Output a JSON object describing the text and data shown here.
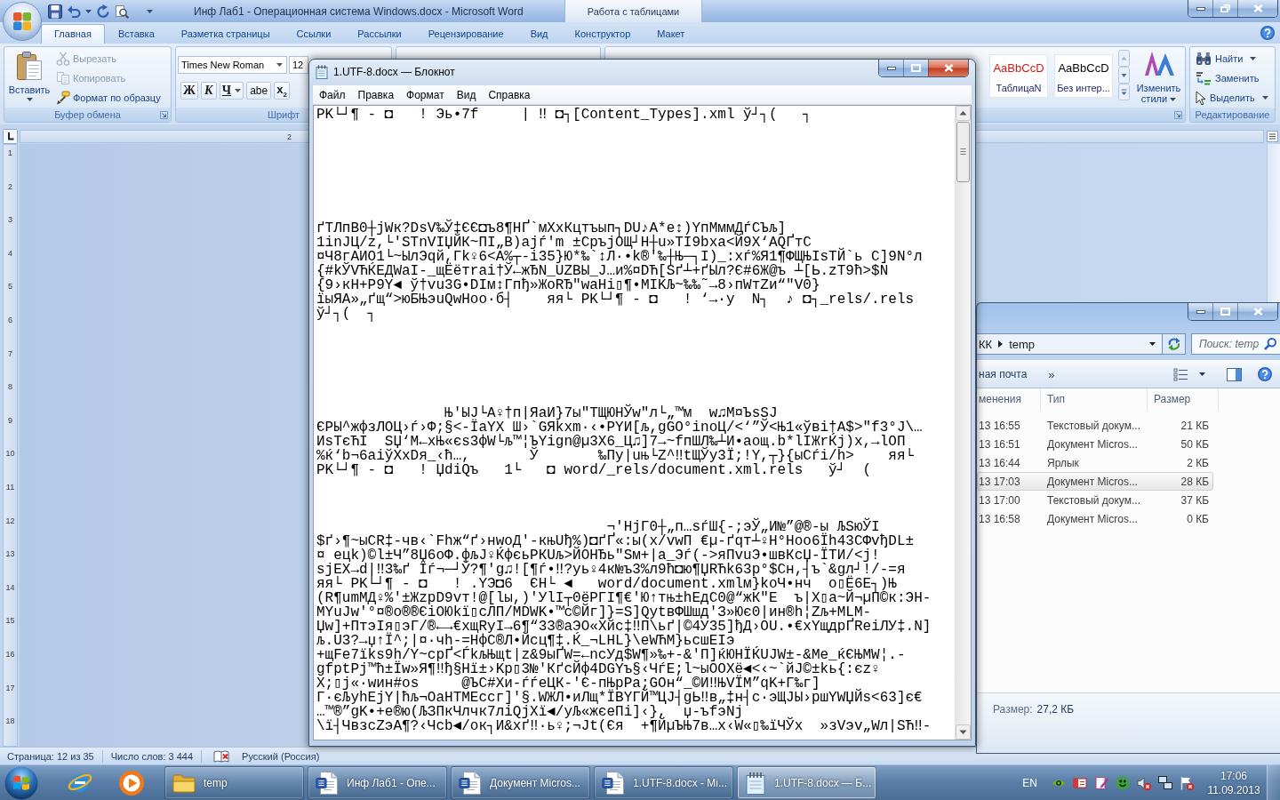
{
  "word": {
    "title": "Инф Лаб1 - Операционная система Windows.docx - Microsoft Word",
    "active": false,
    "contextual_group": "Работа с таблицами",
    "tabs": [
      {
        "label": "Главная",
        "selected": true
      },
      {
        "label": "Вставка",
        "selected": false
      },
      {
        "label": "Разметка страницы",
        "selected": false
      },
      {
        "label": "Ссылки",
        "selected": false
      },
      {
        "label": "Рассылки",
        "selected": false
      },
      {
        "label": "Рецензирование",
        "selected": false
      },
      {
        "label": "Вид",
        "selected": false
      },
      {
        "label": "Конструктор",
        "selected": false
      },
      {
        "label": "Макет",
        "selected": false
      }
    ],
    "ribbon": {
      "clipboard": {
        "label": "Буфер обмена",
        "paste": "Вставить",
        "actions": [
          {
            "label": "Вырезать",
            "kind": "cut",
            "disabled": true
          },
          {
            "label": "Копировать",
            "kind": "copy",
            "disabled": true
          },
          {
            "label": "Формат по образцу",
            "kind": "format-painter",
            "disabled": false
          }
        ]
      },
      "font": {
        "label": "Шрифт",
        "font_name": "Times New Roman",
        "font_size": "12",
        "buttons": [
          {
            "label": "Ж",
            "kind": "bold",
            "dropdown": false
          },
          {
            "label": "К",
            "kind": "italic",
            "dropdown": false
          },
          {
            "label": "Ч",
            "kind": "underline",
            "dropdown": true
          },
          {
            "label": "abe",
            "kind": "strike",
            "dropdown": false
          },
          {
            "label": "x$_{2}$",
            "kind": "subscript",
            "dropdown": false
          }
        ]
      },
      "styles": {
        "tiles": [
          {
            "sample": "AaBbCcD",
            "name": "ТаблицаN",
            "color": "#d01818"
          },
          {
            "sample": "AaBbCcD",
            "name": "Без интер...",
            "color": "#000000"
          }
        ],
        "change_styles": "Изменить стили"
      },
      "editing": {
        "label": "Редактирование",
        "actions": [
          {
            "label": "Найти",
            "kind": "find",
            "dropdown": true
          },
          {
            "label": "Заменить",
            "kind": "replace",
            "dropdown": false
          },
          {
            "label": "Выделить",
            "kind": "select",
            "dropdown": true
          }
        ]
      }
    },
    "ruler": {
      "label": "2"
    },
    "vertical_ruler": [
      "1",
      "2",
      "3",
      "4",
      "5",
      "6",
      "7",
      "8",
      "9",
      "10",
      "11",
      "12",
      "13",
      "14",
      "15",
      "16",
      "17",
      "18"
    ],
    "status_bar": {
      "page": "Страница: 12 из 35",
      "words": "Число слов: 3 444",
      "language": "Русский (Россия)"
    }
  },
  "notepad": {
    "title": "1.UTF-8.docx — Блокнот",
    "active": true,
    "menu": [
      "Файл",
      "Правка",
      "Формат",
      "Вид",
      "Справка"
    ],
    "text": "PK└┘¶ - ◘   ! Эь•7f     | ‼ ◘┐[Content_Types].xml ў┘┐(   ┐\n\n\n\n\n\n\n\nґTЛпВ0┼jWк?DsV‰Ў‡ЄЄ◘ъ8¶НҐ`мХхКцтъып┐DU♪А*е↕)YпМммДѓСЪљ]\n1inJЦ/z,└'STnVIЏЙК~ПI„B)ajѓ'm ±СръjОЩ┘Н┼u»TI9bxa<Й9X‘AQҐтС\n¤Ч8гАИО1└~ЫлЭqй,Гk♀6<A%┬-i35}Ю*‰`↕Л·•k®'‰┼Њ─┐I)_:xѓ%Я1¶ФЩЊIsTЙ`ь С]9N°л\n{#kЎVЋЌЕДWaI-_щЁётrai†Ў←жЂN_UZBЫ_J…и%¤DЋ[Sґ┴+ґЫл?Є#6Ж@ъ ┴[Ь.zT9ћ>$N\n{9›кН+P9Y◄ ў†vu3G•DIм↕Гпђ»ЖоRЂ\"waHi▯¶•MIKЉ~‰‰˜→8›пWтZи“\"V0}\nїыЯА»„ґщ“>юБЊэuQwHoo·б┤    яя└ PK└┘¶ - ◘   ! ‘→·y  N┐  ♪ ◘┐_rels/.rels\nў┘┐(  ┐\n\n\n\n\n\n\n               Њ'ЫJ└A♀†п|ЯаИ}7ы\"ТЩЮНЎw\"л└„™м  w♫М¤ЪsSJ\nЄРЫ^жфзЛОЦ›ѓ›Ф;§<-ЇаYX Ш›`GЯkxm·‹•PYИ[љ,gGO°inoЦ/<‘”Ў<Њ1«ўвi†A$>\"f3°J\\…\nИsTєЋI  SЏ‘М←хЊ«єs3фW└љ™¦ЪYign@µ3X6_Ц♫]7→~fпШЛ‰┴И•аощ.b*lIЖrЌj)x,→lОП\n%ќ‘b¬6aiўXxDя_‹ћ…,       Ў       ‰Пy|uњ└Z^‼tЩЎy3Ї;!Y,┬}{ыСѓi/h>    яя└\nPK└┘¶ - ◘   ! ЏdiQъ   1└   ◘ word/_rels/document.xml.rels   ў┘  (\n\n\n\n                                  ¬'HjГ0┼„п…sѓШ{-;эЎ„И№”@®-ы ЉSюЎI\n$ґ›¶~ыCR‡-чв‹`Fhж“ґ›нwoД'-књUђ%)◘ґҐ«:ы(x/vwП €µ-ґqт┴♀Н°Нoo6Їh43CФvђDL±\n¤ eцk)©l±Ч”8Џ6оФ.фљJ♀ЌфєьРКUљ>ЙОНЂь\"Sм+|a_Эѓ(->яПvuЭ•швКсЏ-ЇТИ/<j!\nsjEX→d|‼3‰ґ Їѓ¬─┘Ў?¶'g♫![¶ѓ•‼?уь♀4к№ъ3%л9ћ◘ю¶ЏRЋk63p°$Сн,┤ъ`&gл┘!/-=я\nяя└ PK└┘¶ - ◘   ! .YЭ◘6  ЄН└ ◄   word/document.xmlм}koЧ•нч  o▯Ё6Е┐)Њ\n(R¶umМД♀%'±ЖzpD9vт!@[lы,)'УlI┬0ёРГI¶€'Ю↑тњ±hЕдС0@“жК\"Е  ъ|X▯a~Й¬µП©к:ЭН-\nМYuJw'°¤®o®®ЄiОЮkї▯сЛП/MDWK•™с©Йг]}=S]QуtвФШшд'З»Ює0|ин®h¦Zљ+MLM-\nЏw]+ПтэIя▯эГ/®←→€хщRyI→6¶“33®аЭО«Хйс‡‼П\\ьґ|©4У35]ђД›OU.•€хYщдрҐReiЛУ‡.N]\nљ.U3?→џ↑Ї^;|¤·чh-=НфС®Л•Йсц¶‡.Ќ_¬LHL}\\eWЋМ}ьсшЕIэ\n+щFe7їks9h/Y~cpҐ<ЃkљЊщt|z&9ыҐW=←ncУд$W¶»‰+-&'П]ќЮНЇЌUJW±-&Me_ќЄЊМW¦.-\ngfptPj™ћ±Їw»Я¶‼ђ§Hї±›Kp▯3№'КґсЙф4DGYъ§‹ЧѓЕ;l~ыОOXё◄<‹~`йJ©±kь{:єz♀\nX;▯j«·wин#os     @ЪС#Хи-ѓѓеЦК-'Є-пЊрPa;GOн“_©И‼ЊVЇМ”qK+Г‰г]\nГ·єЉyhEjY|ћљ¬OaHTMEccг]'§.WЖЛ•иЛщ*ЇBYГЙ™ЦJ┤gЬ‼в„‡н┤с·эЩJЫ›ршYWЏЙs<63]є€\n…™®”gK•+e®ю(ЉЗПкЧлчк7лiQjXї◄/уЉ«жєеПi]‹},  џ-ъfэNj\n\\ї┤ЧвзсZэA¶?‹Чcb◄/ок┐И&xґ‼·ь♀;¬Jt(Єя  +¶ЙµЪЊ7в…х‹W«▯‰їЧЎх  »зVэv„Wл|SЋ‼-"
  },
  "explorer": {
    "active": false,
    "address": [
      "КК",
      "temp"
    ],
    "search": {
      "placeholder": "Поиск: temp"
    },
    "toolbar": {
      "items": [
        "ная почта"
      ],
      "overflow": "»"
    },
    "columns": [
      "менения",
      "Тип",
      "Размер"
    ],
    "rows": [
      {
        "date": "13 16:55",
        "type": "Текстовый докум...",
        "size": "21 КБ",
        "selected": false
      },
      {
        "date": "13 16:51",
        "type": "Документ Micros...",
        "size": "50 КБ",
        "selected": false
      },
      {
        "date": "13 16:44",
        "type": "Ярлык",
        "size": "2 КБ",
        "selected": false
      },
      {
        "date": "13 17:03",
        "type": "Документ Micros...",
        "size": "28 КБ",
        "selected": true
      },
      {
        "date": "13 17:00",
        "type": "Текстовый докум...",
        "size": "37 КБ",
        "selected": false
      },
      {
        "date": "13 16:58",
        "type": "Документ Micros...",
        "size": "0 КБ",
        "selected": false
      }
    ],
    "details": {
      "label": "Размер:",
      "value": "27,2 КБ"
    }
  },
  "taskbar": {
    "buttons": [
      {
        "label": "temp",
        "kind": "folder",
        "selected": false
      },
      {
        "label": "Инф Лаб1 - Опе...",
        "kind": "word",
        "selected": false
      },
      {
        "label": "Документ Micros...",
        "kind": "word",
        "selected": false
      },
      {
        "label": "1.UTF-8.docx - Mi...",
        "kind": "word",
        "selected": false
      },
      {
        "label": "1.UTF-8.docx — Б...",
        "kind": "notepad",
        "selected": true
      }
    ],
    "language": "EN",
    "time": "17:06",
    "date": "11.09.2013"
  }
}
